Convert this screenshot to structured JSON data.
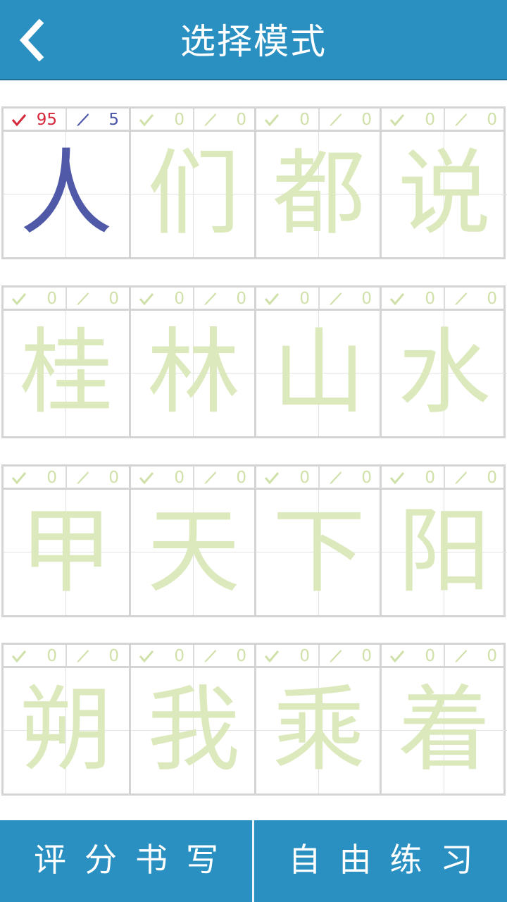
{
  "header": {
    "title": "选择模式",
    "back_icon": "chevron-left-icon"
  },
  "colors": {
    "header": "#2a90c2",
    "done_glyph": "#5059a8",
    "pending_glyph": "#dce9bd",
    "check_red": "#d6283a"
  },
  "rows": [
    {
      "cells": [
        {
          "char": "人",
          "score": "95",
          "attempts": "5",
          "done": true
        },
        {
          "char": "们",
          "score": "0",
          "attempts": "0",
          "done": false
        },
        {
          "char": "都",
          "score": "0",
          "attempts": "0",
          "done": false
        },
        {
          "char": "说",
          "score": "0",
          "attempts": "0",
          "done": false
        }
      ]
    },
    {
      "cells": [
        {
          "char": "桂",
          "score": "0",
          "attempts": "0",
          "done": false
        },
        {
          "char": "林",
          "score": "0",
          "attempts": "0",
          "done": false
        },
        {
          "char": "山",
          "score": "0",
          "attempts": "0",
          "done": false
        },
        {
          "char": "水",
          "score": "0",
          "attempts": "0",
          "done": false
        }
      ]
    },
    {
      "cells": [
        {
          "char": "甲",
          "score": "0",
          "attempts": "0",
          "done": false
        },
        {
          "char": "天",
          "score": "0",
          "attempts": "0",
          "done": false
        },
        {
          "char": "下",
          "score": "0",
          "attempts": "0",
          "done": false
        },
        {
          "char": "阳",
          "score": "0",
          "attempts": "0",
          "done": false
        }
      ]
    },
    {
      "cells": [
        {
          "char": "朔",
          "score": "0",
          "attempts": "0",
          "done": false
        },
        {
          "char": "我",
          "score": "0",
          "attempts": "0",
          "done": false
        },
        {
          "char": "乘",
          "score": "0",
          "attempts": "0",
          "done": false
        },
        {
          "char": "着",
          "score": "0",
          "attempts": "0",
          "done": false
        }
      ]
    }
  ],
  "footer": {
    "left_label": "评分书写",
    "right_label": "自由练习"
  }
}
